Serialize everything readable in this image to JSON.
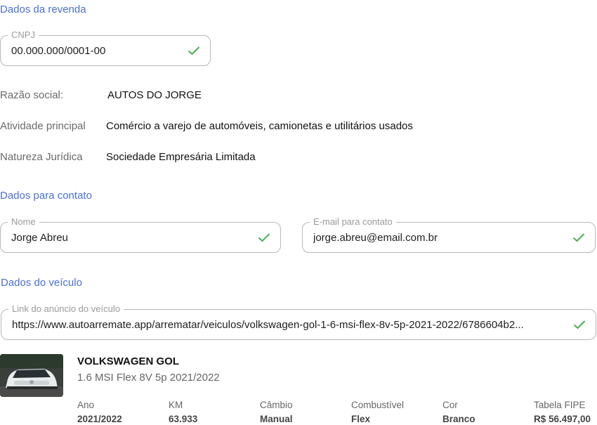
{
  "sections": {
    "revenda": "Dados da revenda",
    "contato": "Dados para contato",
    "veiculo": "Dados do veículo"
  },
  "cnpj": {
    "label": "CNPJ",
    "value": "00.000.000/0001-00"
  },
  "company": {
    "razao_label": "Razão social:",
    "razao_value": "AUTOS DO JORGE",
    "atividade_label": "Atividade principal",
    "atividade_value": "Comércio a varejo de automóveis, camionetas e utilitários usados",
    "natureza_label": "Natureza Jurídica",
    "natureza_value": "Sociedade Empresária Limitada"
  },
  "contact": {
    "name_label": "Nome",
    "name_value": "Jorge Abreu",
    "email_label": "E-mail para contato",
    "email_value": "jorge.abreu@email.com.br"
  },
  "vehicle": {
    "link_label": "Link do anúncio do veículo",
    "link_value": "https://www.autoarremate.app/arrematar/veiculos/volkswagen-gol-1-6-msi-flex-8v-5p-2021-2022/6786604b2...",
    "name": "VOLKSWAGEN GOL",
    "subtitle": "1.6 MSI Flex 8V 5p 2021/2022",
    "specs": [
      {
        "label": "Ano",
        "value": "2021/2022"
      },
      {
        "label": "KM",
        "value": "63.933"
      },
      {
        "label": "Câmbio",
        "value": "Manual"
      },
      {
        "label": "Combustível",
        "value": "Flex"
      },
      {
        "label": "Cor",
        "value": "Branco"
      },
      {
        "label": "Tabela FIPE",
        "value": "R$ 56.497,00"
      }
    ]
  },
  "colors": {
    "accent": "#4a6fd8",
    "check": "#4caf50",
    "border": "#b9b9b9"
  },
  "icons": {
    "valid": "check-icon",
    "car_photo": "car-image"
  }
}
